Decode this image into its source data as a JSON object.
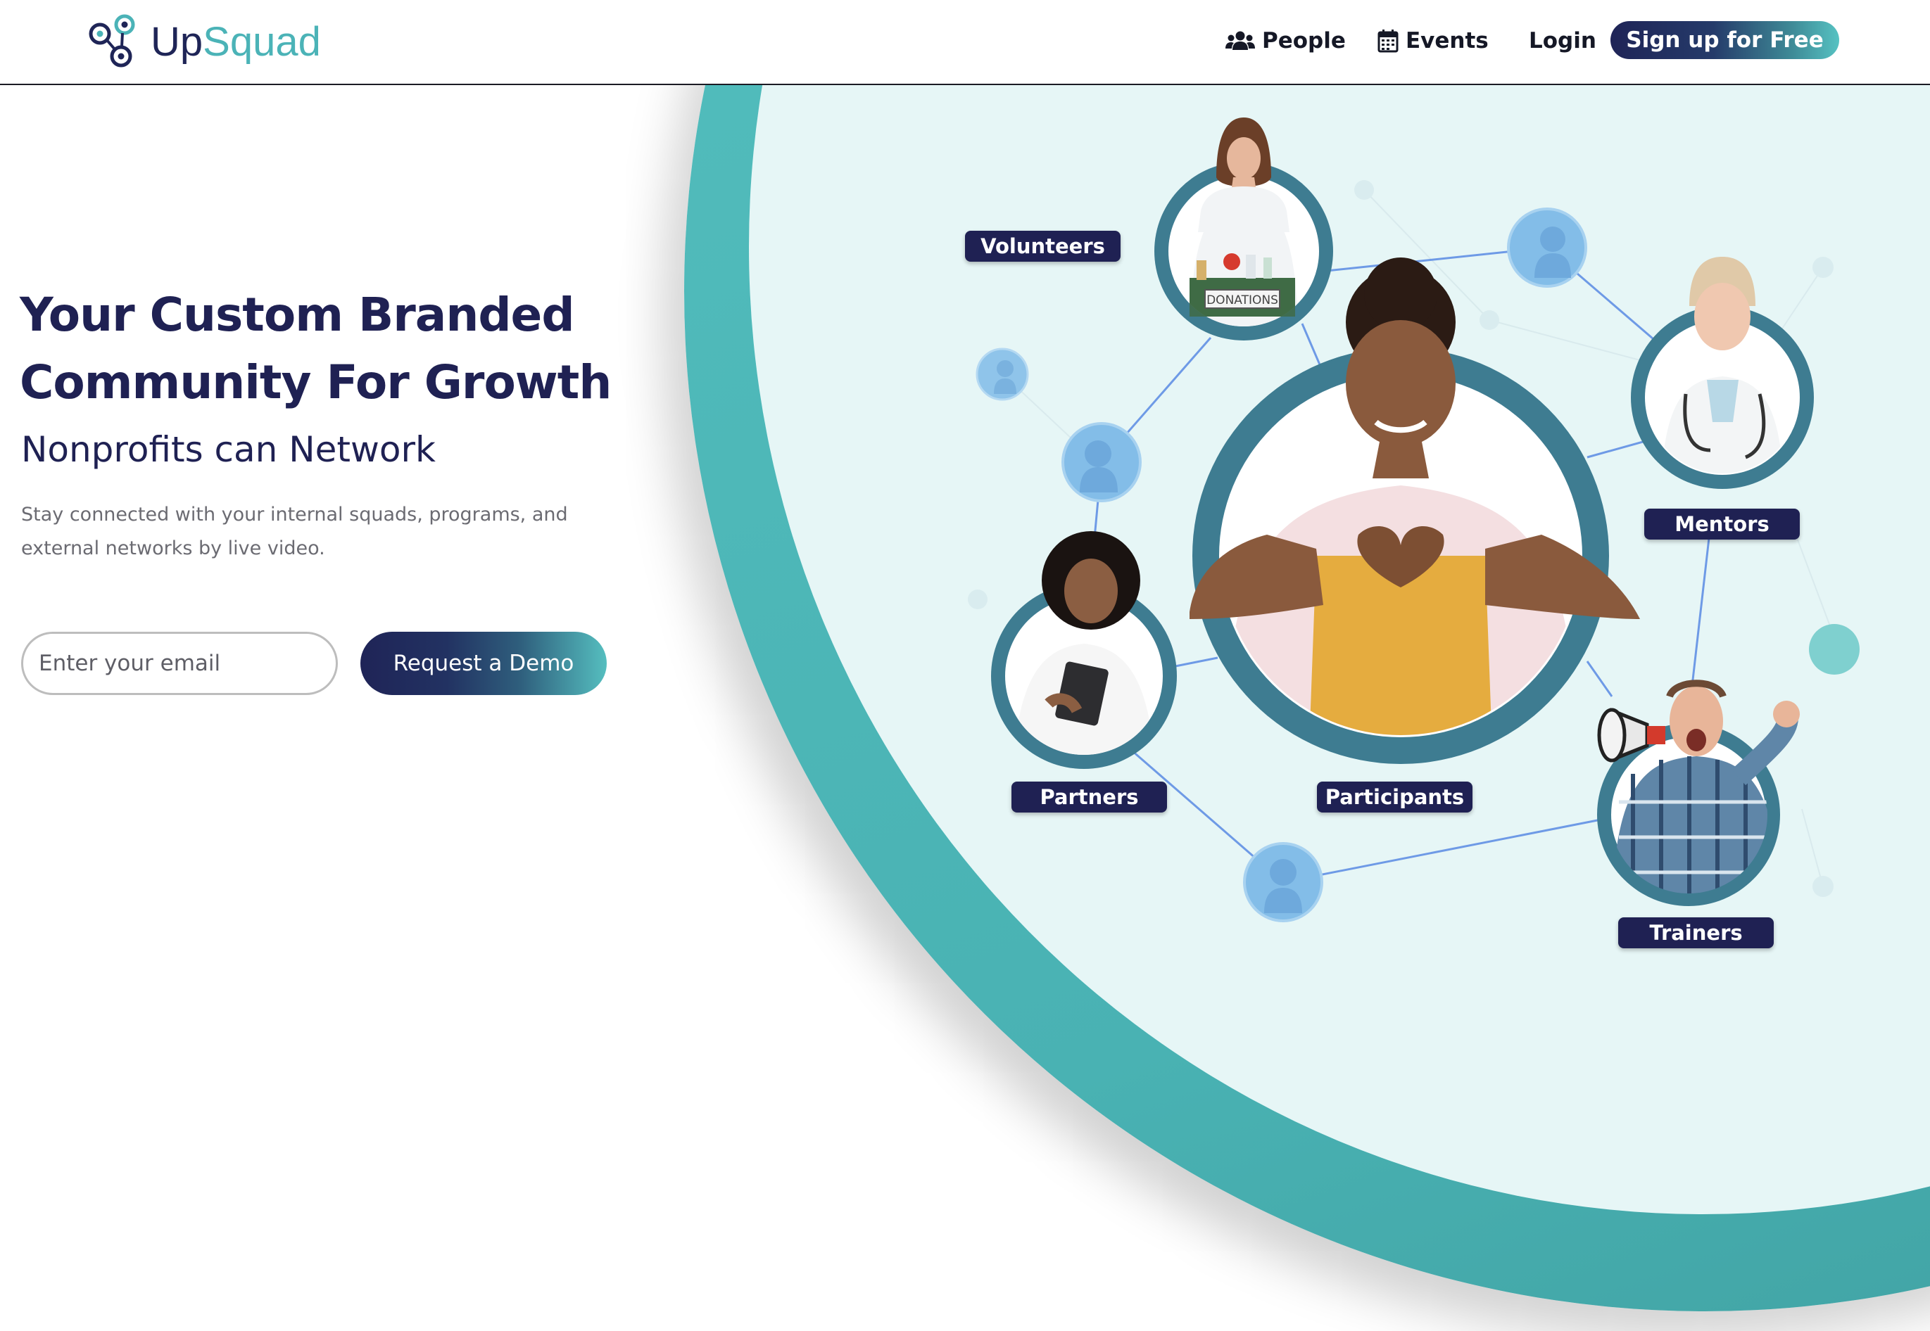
{
  "header": {
    "logo": {
      "icon": "upsquad-logo-icon",
      "text_up": "Up",
      "text_squad": "Squad"
    },
    "nav": [
      {
        "label": "People",
        "icon": "users-icon"
      },
      {
        "label": "Events",
        "icon": "calendar-icon"
      },
      {
        "label": "Login"
      }
    ],
    "signup_label": "Sign up for Free"
  },
  "hero": {
    "title_line1": "Your Custom Branded",
    "title_line2": "Community For Growth",
    "subtitle": "Nonprofits can Network",
    "description": "Stay connected with your internal squads, programs, and external networks by live video.",
    "email_placeholder": "Enter your email",
    "demo_label": "Request a Demo"
  },
  "network": {
    "labels": {
      "volunteers": "Volunteers",
      "mentors": "Mentors",
      "partners": "Partners",
      "participants": "Participants",
      "trainers": "Trainers"
    },
    "donations_text": "DONATIONS"
  },
  "colors": {
    "navy": "#1f2153",
    "teal": "#56c2c1",
    "ring": "#3e7c91",
    "light_bg": "#e6f6f6",
    "node_blue": "#7fb6e8",
    "line_blue": "#6e9ae6"
  }
}
